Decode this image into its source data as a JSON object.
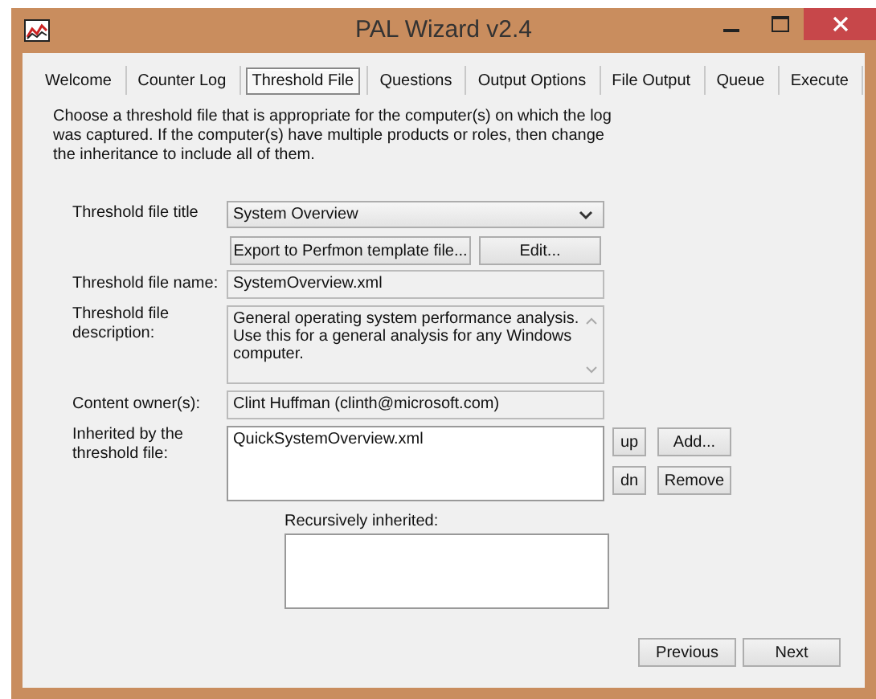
{
  "window": {
    "title": "PAL Wizard v2.4"
  },
  "tabs": [
    {
      "label": "Welcome",
      "selected": false
    },
    {
      "label": "Counter Log",
      "selected": false
    },
    {
      "label": "Threshold File",
      "selected": true
    },
    {
      "label": "Questions",
      "selected": false
    },
    {
      "label": "Output Options",
      "selected": false
    },
    {
      "label": "File Output",
      "selected": false
    },
    {
      "label": "Queue",
      "selected": false
    },
    {
      "label": "Execute",
      "selected": false
    }
  ],
  "instructions": "Choose a threshold file that is appropriate for the computer(s) on which the log was captured. If the computer(s) have multiple products or roles, then change the inheritance to include all of them.",
  "form": {
    "title_label": "Threshold file title",
    "title_value": "System Overview",
    "export_button": "Export to Perfmon template file...",
    "edit_button": "Edit...",
    "name_label": "Threshold file name:",
    "name_value": "SystemOverview.xml",
    "description_label": "Threshold file description:",
    "description_value": "General operating system performance analysis. Use this for a general analysis for any Windows computer.",
    "owner_label": "Content owner(s):",
    "owner_value": "Clint Huffman (clinth@microsoft.com)",
    "inherited_label": "Inherited by the threshold file:",
    "inherited_items": [
      "QuickSystemOverview.xml"
    ],
    "up_button": "up",
    "add_button": "Add...",
    "dn_button": "dn",
    "remove_button": "Remove",
    "recursive_label": "Recursively inherited:"
  },
  "buttons": [
    "Previous",
    "Next"
  ]
}
